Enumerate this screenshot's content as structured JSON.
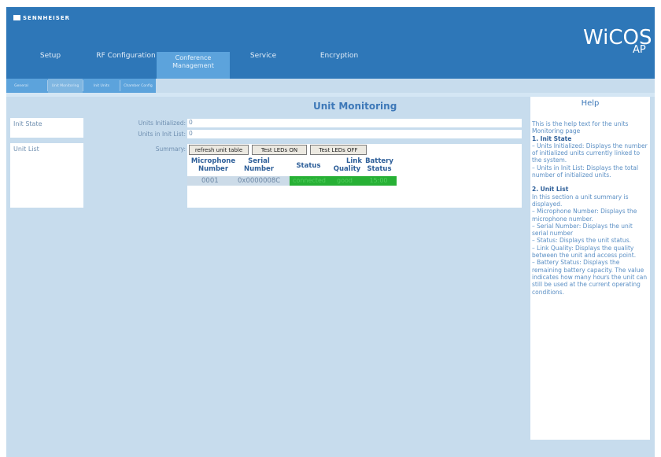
{
  "brand": {
    "logo": "SENNHEISER",
    "product": "WiCOS",
    "product_sub": "AP"
  },
  "nav": {
    "tabs": [
      {
        "label": "Setup"
      },
      {
        "label": "RF Configuration"
      },
      {
        "label": "Conference Management",
        "active": true
      },
      {
        "label": "Service"
      },
      {
        "label": "Encryption"
      }
    ]
  },
  "subnav": {
    "tabs": [
      {
        "label": "General"
      },
      {
        "label": "Unit Monitoring",
        "active": true
      },
      {
        "label": "Init Units"
      },
      {
        "label": "Chamber Config"
      }
    ]
  },
  "page": {
    "title": "Unit Monitoring"
  },
  "init_state": {
    "section_label": "Init State",
    "units_initialized_label": "Units Initialized:",
    "units_initialized_value": "0",
    "units_in_init_list_label": "Units in Init List:",
    "units_in_init_list_value": "0"
  },
  "unit_list": {
    "section_label": "Unit List",
    "summary_label": "Summary:",
    "buttons": {
      "refresh": "refresh unit table",
      "leds_on": "Test LEDs ON",
      "leds_off": "Test LEDs OFF"
    },
    "columns": {
      "mic_line1": "Microphone",
      "mic_line2": "Number",
      "serial_line1": "Serial",
      "serial_line2": "Number",
      "status": "Status",
      "link_line1": "Link",
      "link_line2": "Quality",
      "battery_line1": "Battery",
      "battery_line2": "Status"
    },
    "rows": [
      {
        "mic": "0001",
        "serial": "0x0000008C",
        "status": "connected",
        "link": "good",
        "battery": "15:00"
      }
    ]
  },
  "help": {
    "title": "Help",
    "intro": "This is the help text for the units Monitoring page",
    "s1_title": "1. Init State",
    "s1_l1": "– Units Initialized: Displays the number of initialized units currently linked to the system.",
    "s1_l2": "– Units in Init List: Displays the total number of initialized units.",
    "s2_title": "2. Unit List",
    "s2_l0": "In this section a unit summary is displayed.",
    "s2_l1": "– Microphone Number: Displays the microphone number.",
    "s2_l2": "– Serial Number: Displays the unit serial number",
    "s2_l3": "– Status: Displays the unit status.",
    "s2_l4": "– Link Quality: Displays the quality between the unit and access point.",
    "s2_l5": "– Battery Status: Displays the remaining battery capacity. The value indicates how many hours the unit can still be used at the current operating conditions."
  },
  "colors": {
    "header": "#2e77b8",
    "active_tab": "#5ca3dc",
    "content_bg": "#c7dced",
    "status_green": "#27b035"
  }
}
